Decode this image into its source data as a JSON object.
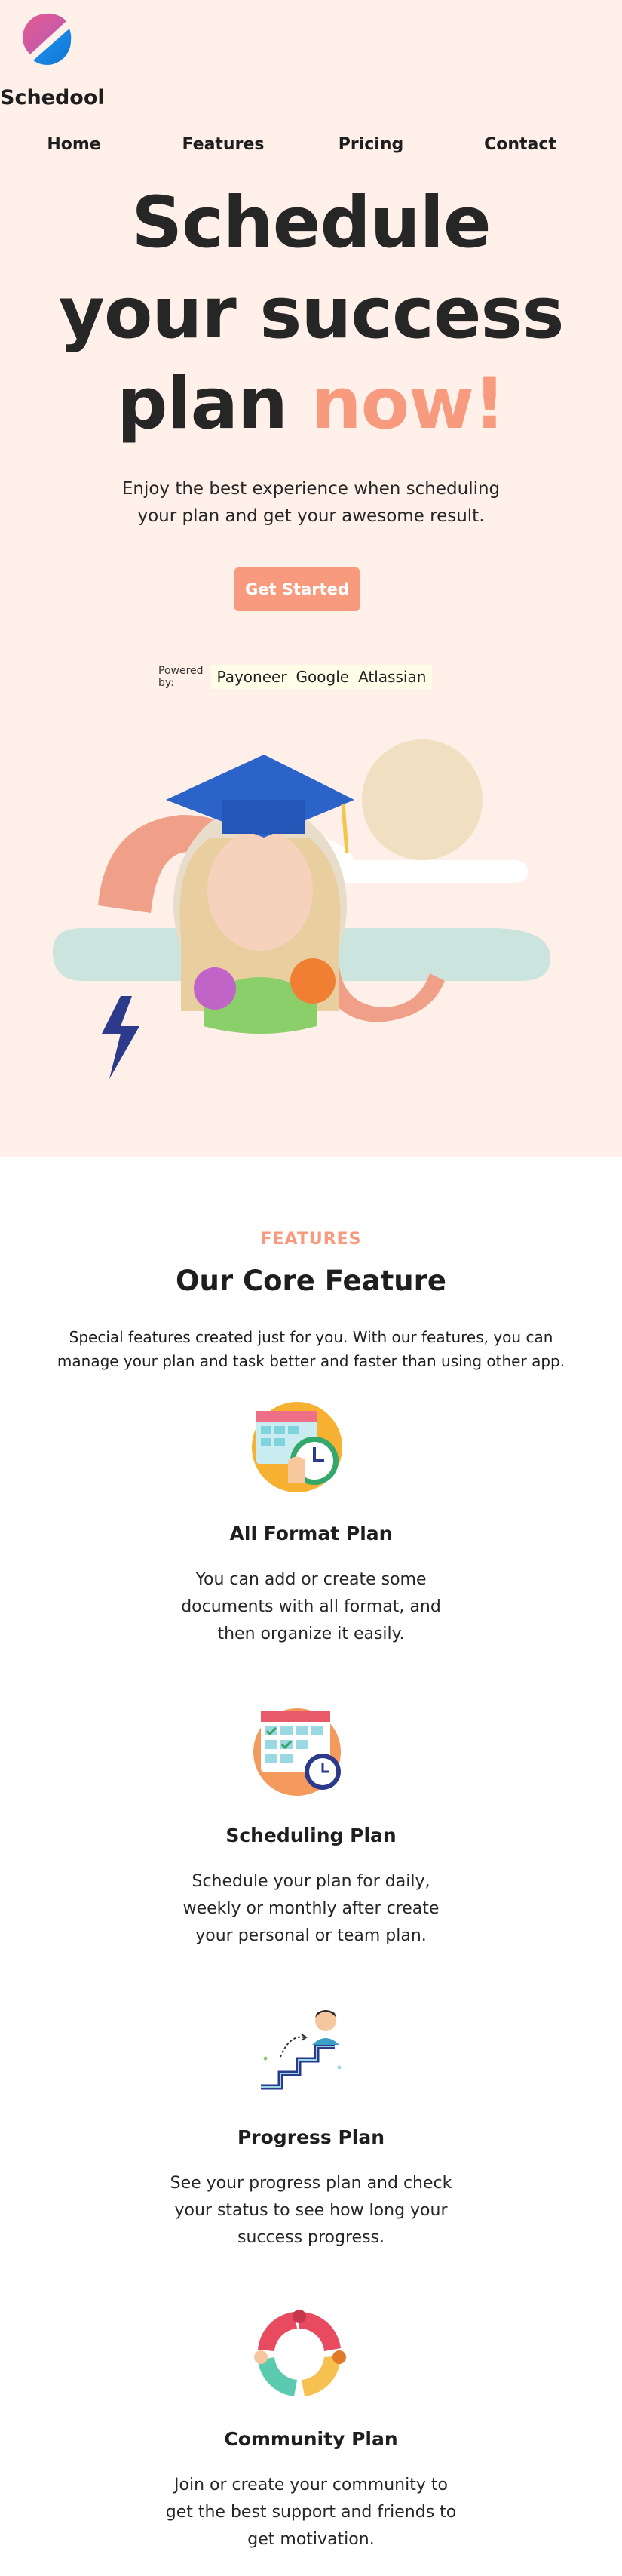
{
  "brand": {
    "name": "Schedool"
  },
  "nav": {
    "items": [
      "Home",
      "Features",
      "Pricing",
      "Contact"
    ]
  },
  "hero": {
    "headline_line1": "Schedule",
    "headline_line2": "your success",
    "headline_line3_plain": "plan ",
    "headline_line3_accent": "now!",
    "subtext": "Enjoy the best experience when scheduling your plan and get your awesome result.",
    "cta_label": "Get Started",
    "powered_label": "Powered by:",
    "partners": [
      "Payoneer",
      "Google",
      "Atlassian"
    ]
  },
  "features": {
    "eyebrow": "FEATURES",
    "title": "Our Core Feature",
    "description": "Special features created just for you. With our features, you can manage your plan and task better and faster than using other app.",
    "items": [
      {
        "name": "All Format Plan",
        "text": "You can add or create some documents with all format, and then organize it easily.",
        "icon": "document-clock-icon"
      },
      {
        "name": "Scheduling Plan",
        "text": "Schedule your plan for daily, weekly or monthly after create your personal or team plan.",
        "icon": "calendar-clock-icon"
      },
      {
        "name": "Progress Plan",
        "text": "See your progress plan and check your status to see how long your success progress.",
        "icon": "stairs-progress-icon"
      },
      {
        "name": "Community Plan",
        "text": "Join or create your community to get the best support and friends to get motivation.",
        "icon": "community-circle-icon"
      }
    ]
  },
  "colors": {
    "accent": "#f79a7e",
    "hero_bg": "#fff0e9",
    "text": "#262626"
  }
}
